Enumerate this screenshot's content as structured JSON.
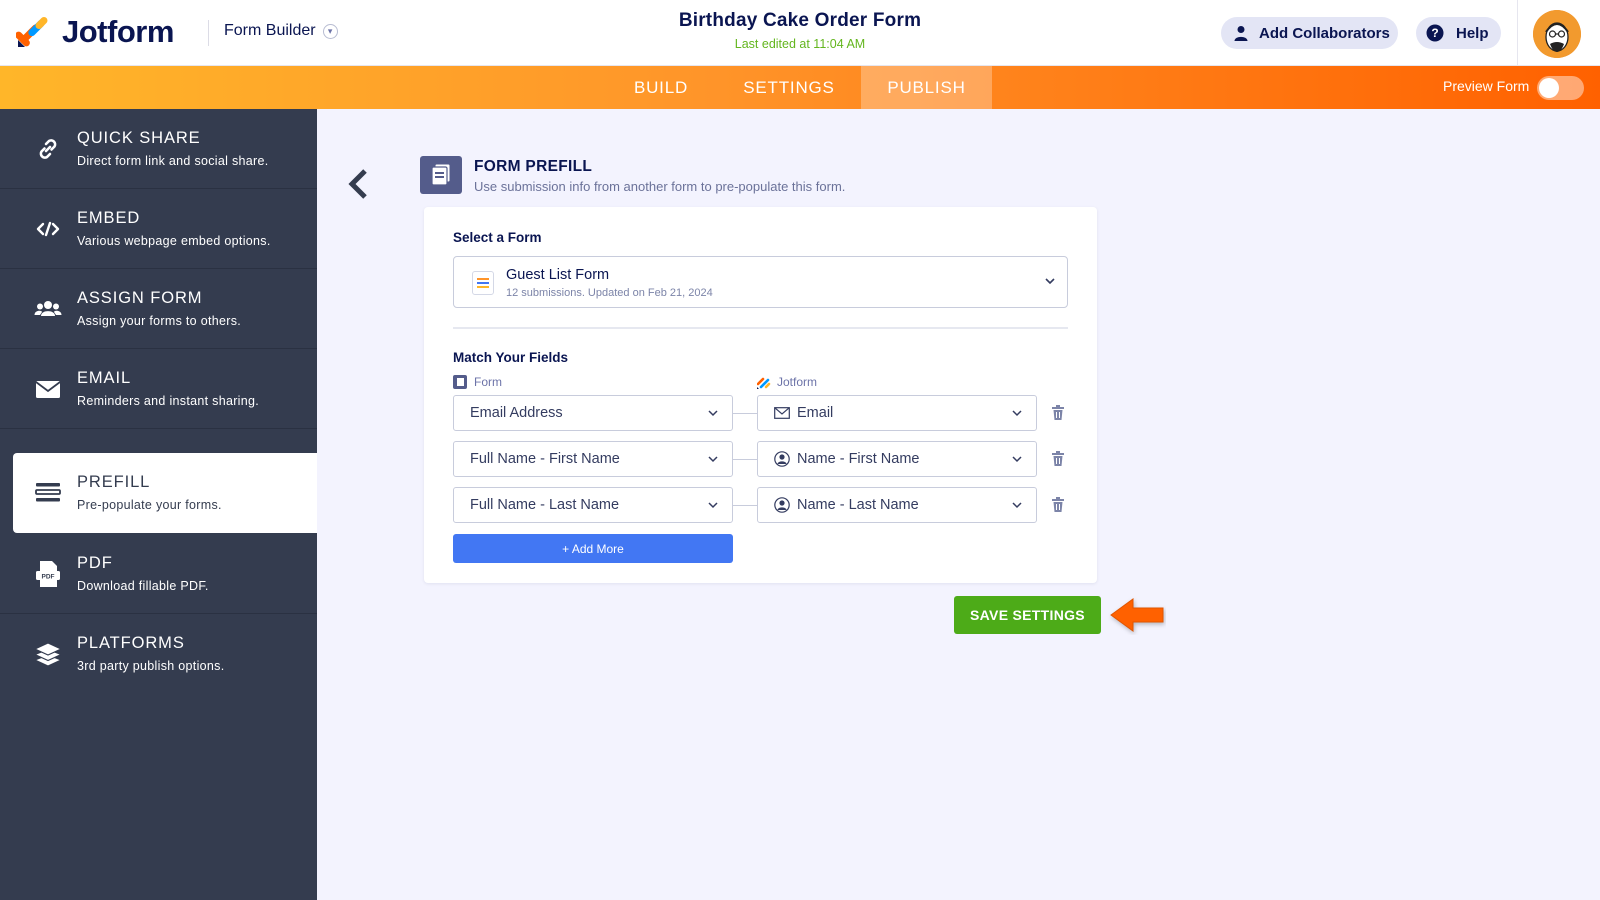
{
  "header": {
    "brand": "Jotform",
    "builder_label": "Form Builder",
    "form_title": "Birthday Cake Order Form",
    "last_edited": "Last edited at 11:04 AM",
    "collaborators_label": "Add Collaborators",
    "help_label": "Help"
  },
  "nav": {
    "tabs": [
      {
        "label": "BUILD",
        "active": false
      },
      {
        "label": "SETTINGS",
        "active": false
      },
      {
        "label": "PUBLISH",
        "active": true
      }
    ],
    "preview_label": "Preview Form",
    "preview_on": false
  },
  "sidebar": {
    "items": [
      {
        "title": "QUICK SHARE",
        "desc": "Direct form link and social share.",
        "icon": "link-icon"
      },
      {
        "title": "EMBED",
        "desc": "Various webpage embed options.",
        "icon": "code-icon"
      },
      {
        "title": "ASSIGN FORM",
        "desc": "Assign your forms to others.",
        "icon": "users-icon"
      },
      {
        "title": "EMAIL",
        "desc": "Reminders and instant sharing.",
        "icon": "envelope-icon"
      },
      {
        "title": "PREFILL",
        "desc": "Pre-populate your forms.",
        "icon": "prefill-icon",
        "active": true
      },
      {
        "title": "PDF",
        "desc": "Download fillable PDF.",
        "icon": "pdf-icon"
      },
      {
        "title": "PLATFORMS",
        "desc": "3rd party publish options.",
        "icon": "layers-icon"
      }
    ]
  },
  "prefill": {
    "title": "FORM PREFILL",
    "subtitle": "Use submission info from another form to pre-populate this form.",
    "select_label": "Select a Form",
    "selected_form": {
      "name": "Guest List Form",
      "meta": "12 submissions. Updated on Feb 21, 2024"
    },
    "match_label": "Match Your Fields",
    "col_form": "Form",
    "col_jotform": "Jotform",
    "rows": [
      {
        "source": "Email Address",
        "target": "Email",
        "target_icon": "envelope-icon"
      },
      {
        "source": "Full Name - First Name",
        "target": "Name - First Name",
        "target_icon": "person-icon"
      },
      {
        "source": "Full Name - Last Name",
        "target": "Name - Last Name",
        "target_icon": "person-icon"
      }
    ],
    "add_more_label": "+ Add More",
    "save_label": "SAVE SETTINGS"
  },
  "colors": {
    "accent_orange": "#ff6100",
    "save_green": "#4dab18",
    "add_more_blue": "#4277f3",
    "sidebar_bg": "#343c4f",
    "edited_green": "#63b61e"
  }
}
